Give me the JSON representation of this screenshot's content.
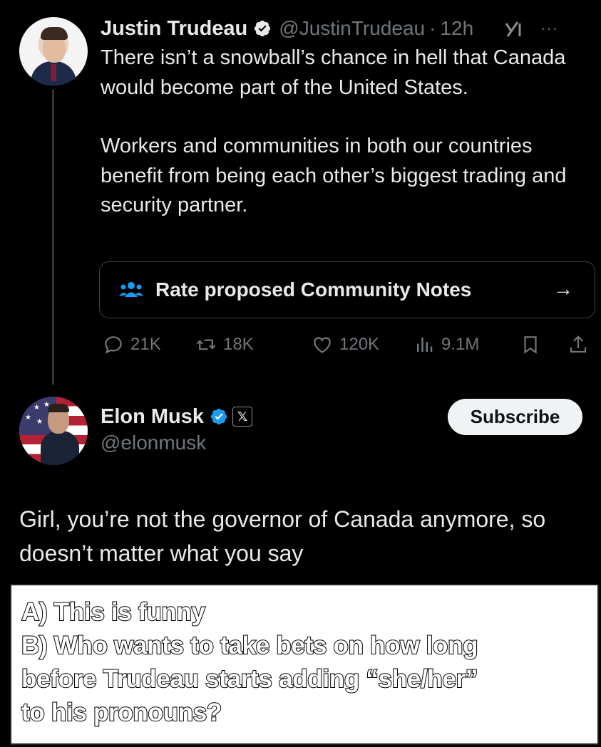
{
  "tweet1": {
    "author_name": "Justin Trudeau",
    "handle": "@JustinTrudeau",
    "separator": "·",
    "time": "12h",
    "verified_icon": "verified-badge-icon",
    "more_icon_text": "···",
    "paragraphs": [
      "There isn’t a snowball’s chance in hell that Canada would become part of the United States.",
      "Workers and communities in both our countries benefit from being each other’s biggest trading and security partner."
    ],
    "community_notes": {
      "label": "Rate proposed Community Notes",
      "arrow": "→"
    },
    "actions": {
      "replies": "21K",
      "reposts": "18K",
      "likes": "120K",
      "views": "9.1M"
    },
    "colors": {
      "text": "#e7e9ea",
      "muted": "#71767b",
      "verified": "#1d9bf0"
    }
  },
  "tweet2": {
    "author_name": "Elon Musk",
    "handle": "@elonmusk",
    "affiliate_badge": "𝕏",
    "subscribe_label": "Subscribe",
    "text": "Girl, you’re not the governor of Canada anymore, so doesn’t matter what you say"
  },
  "caption": {
    "lines": [
      "A) This is funny",
      "B) Who wants to take bets on how long",
      "before Trudeau starts adding “she/her”",
      "to his pronouns?"
    ]
  }
}
